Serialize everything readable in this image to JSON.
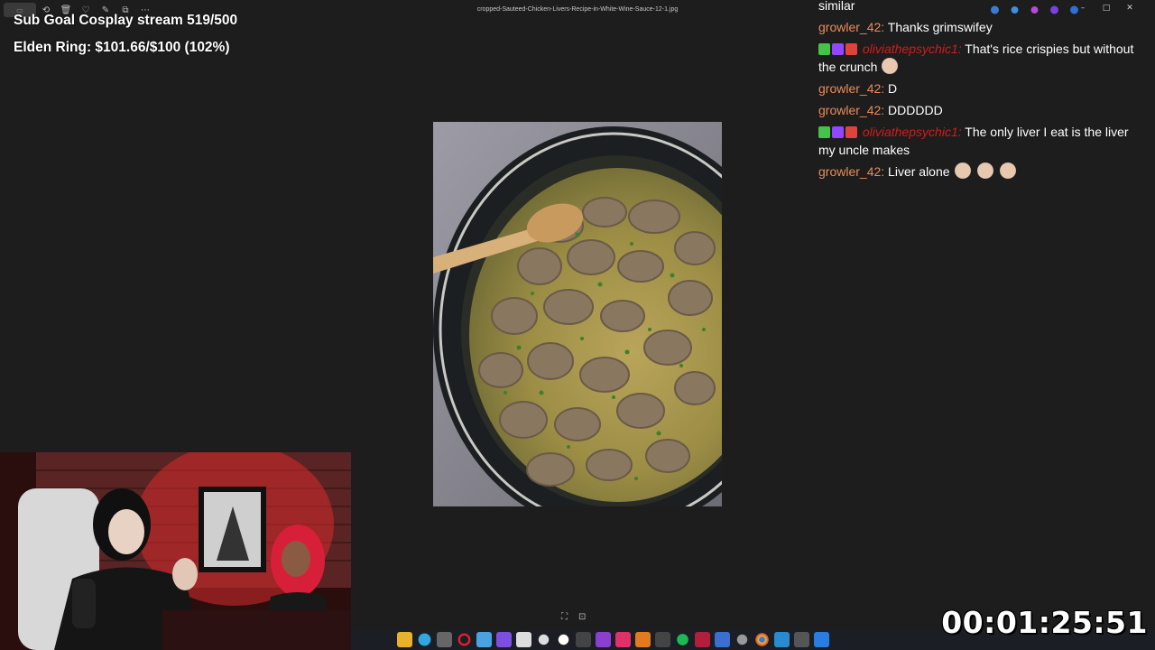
{
  "viewer": {
    "filename": "cropped-Sauteed-Chicken-Livers-Recipe-in-White-Wine-Sauce-12-1.jpg",
    "minimize": "–",
    "maximize": "□",
    "close": "✕"
  },
  "overlay": {
    "sub_goal": "Sub Goal Cosplay stream 519/500",
    "donation_goal": "Elden Ring: $101.66/$100 (102%)"
  },
  "chat": {
    "overflow_text": "similar",
    "messages": [
      {
        "user": "growler_42:",
        "text": "Thanks grimswifey",
        "style": "normal",
        "badges": false,
        "emotes": 0
      },
      {
        "user": "oliviathepsychic1:",
        "text": "That's rice crispies but without the crunch",
        "style": "red",
        "badges": true,
        "emotes": 1
      },
      {
        "user": "growler_42:",
        "text": "D",
        "style": "normal",
        "badges": false,
        "emotes": 0
      },
      {
        "user": "growler_42:",
        "text": "DDDDDD",
        "style": "normal",
        "badges": false,
        "emotes": 0
      },
      {
        "user": "oliviathepsychic1:",
        "text": "The only liver I eat is the liver my uncle makes",
        "style": "red",
        "badges": true,
        "emotes": 0
      },
      {
        "user": "growler_42:",
        "text": "Liver alone",
        "style": "normal",
        "badges": false,
        "emotes": 3
      }
    ]
  },
  "timer": "00:01:25:51",
  "colors": {
    "chat_name": "#e88c5a",
    "chat_name_red": "#d21d1d",
    "background": "#1d1d1d"
  },
  "icons": {
    "toolbar": [
      "see-all-icon",
      "rotate-icon",
      "delete-icon",
      "favorite-icon",
      "edit-icon",
      "crop-icon",
      "more-icon"
    ],
    "taskbar": [
      "file-explorer-icon",
      "edge-icon",
      "store-icon",
      "obs-icon",
      "settings-icon",
      "spotify-icon",
      "chrome-icon",
      "steam-icon",
      "photos-icon"
    ]
  }
}
